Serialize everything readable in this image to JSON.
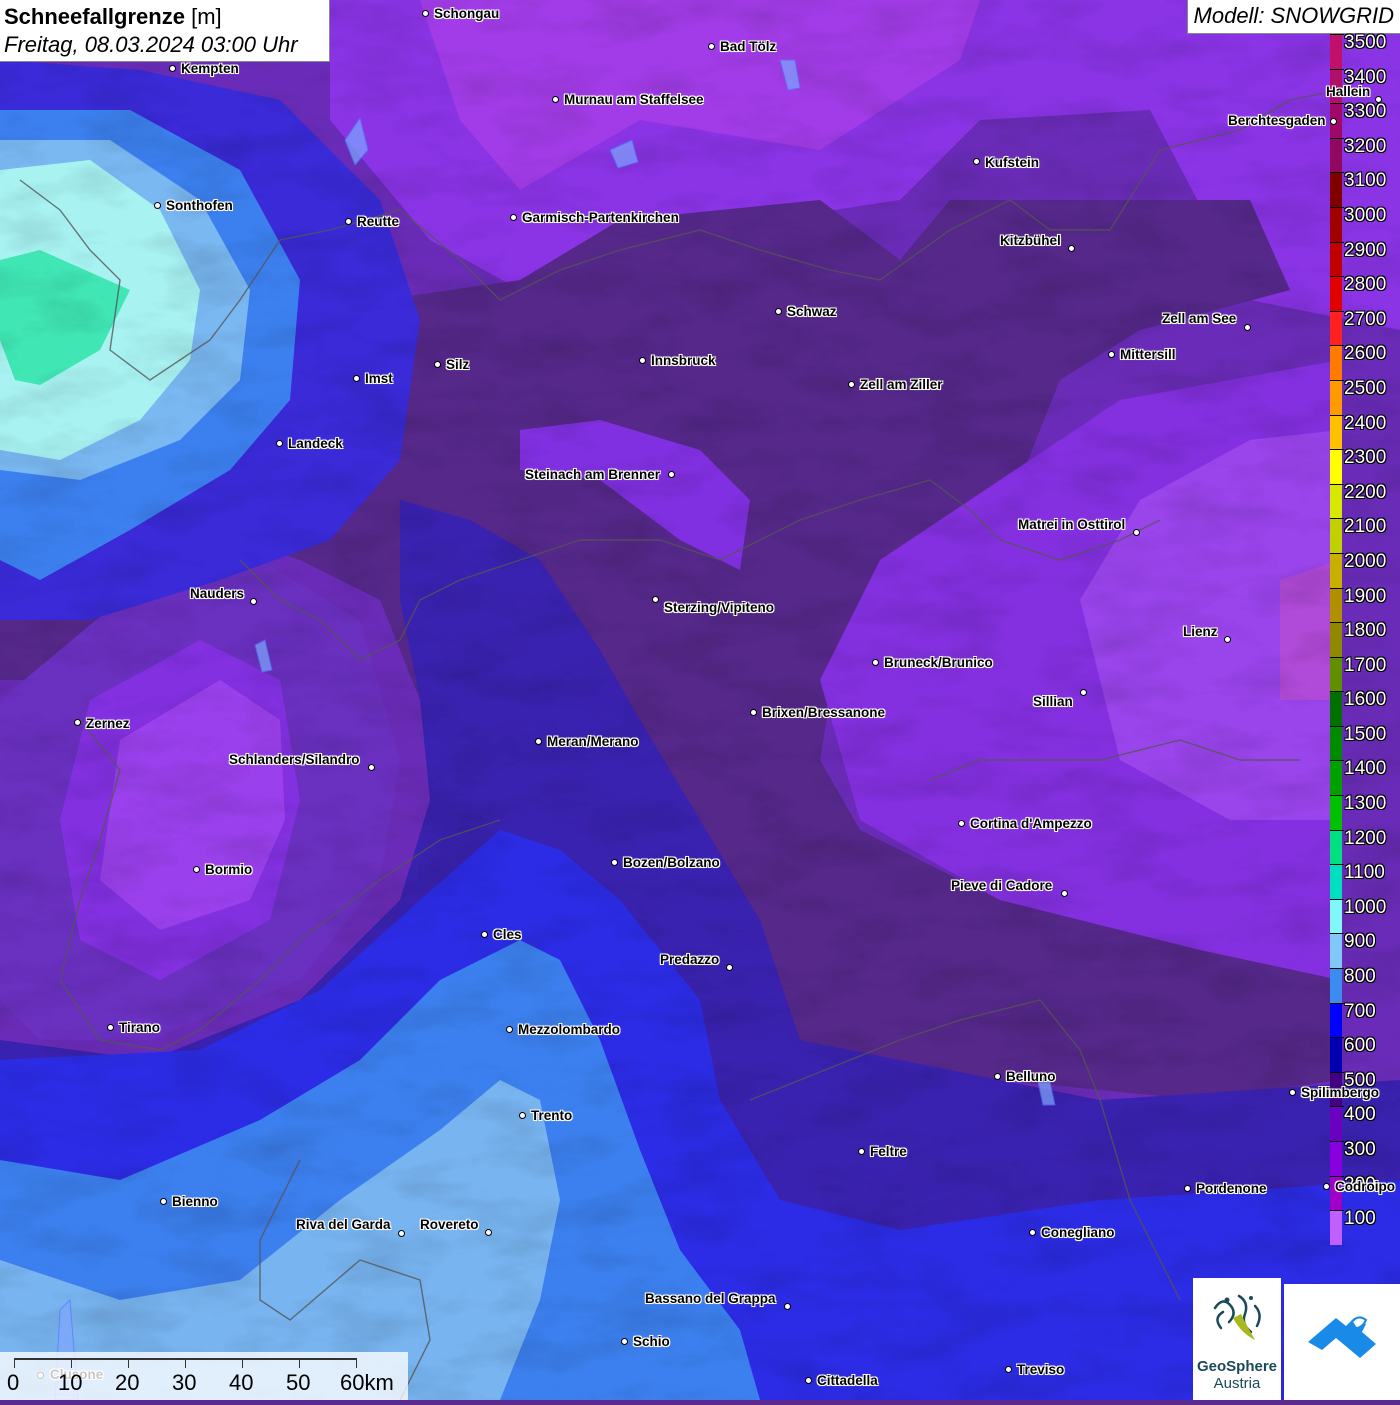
{
  "title": {
    "main_bold": "Schneefallgrenze",
    "main_unit": "[m]",
    "subtitle": "Freitag, 08.03.2024 03:00 Uhr"
  },
  "model": {
    "label": "Modell: SNOWGRID"
  },
  "legend": {
    "items": [
      {
        "label": "3500",
        "color": "#c0106a"
      },
      {
        "label": "3400",
        "color": "#b0106a"
      },
      {
        "label": "3300",
        "color": "#a00868"
      },
      {
        "label": "3200",
        "color": "#900860"
      },
      {
        "label": "3100",
        "color": "#800000"
      },
      {
        "label": "3000",
        "color": "#a00000"
      },
      {
        "label": "2900",
        "color": "#c00000"
      },
      {
        "label": "2800",
        "color": "#e00000"
      },
      {
        "label": "2700",
        "color": "#ff2020"
      },
      {
        "label": "2600",
        "color": "#ff7a00"
      },
      {
        "label": "2500",
        "color": "#ff9a00"
      },
      {
        "label": "2400",
        "color": "#ffc000"
      },
      {
        "label": "2300",
        "color": "#ffff00"
      },
      {
        "label": "2200",
        "color": "#d8e800"
      },
      {
        "label": "2100",
        "color": "#c0d000"
      },
      {
        "label": "2000",
        "color": "#c8b000"
      },
      {
        "label": "1900",
        "color": "#b09000"
      },
      {
        "label": "1800",
        "color": "#908800"
      },
      {
        "label": "1700",
        "color": "#609000"
      },
      {
        "label": "1600",
        "color": "#007000"
      },
      {
        "label": "1500",
        "color": "#008a00"
      },
      {
        "label": "1400",
        "color": "#00a000"
      },
      {
        "label": "1300",
        "color": "#00c000"
      },
      {
        "label": "1200",
        "color": "#00e080"
      },
      {
        "label": "1100",
        "color": "#00e0c0"
      },
      {
        "label": "1000",
        "color": "#80f8f8"
      },
      {
        "label": "900",
        "color": "#80c8f8"
      },
      {
        "label": "800",
        "color": "#3c8cf0"
      },
      {
        "label": "700",
        "color": "#0000ff"
      },
      {
        "label": "600",
        "color": "#0000b0"
      },
      {
        "label": "500",
        "color": "#400080"
      },
      {
        "label": "400",
        "color": "#6a00c0"
      },
      {
        "label": "300",
        "color": "#8800e0"
      },
      {
        "label": "200",
        "color": "#a000c8"
      },
      {
        "label": "100",
        "color": "#c060ff"
      }
    ]
  },
  "cities": [
    {
      "name": "Schongau"
    },
    {
      "name": "Bad Tölz"
    },
    {
      "name": "Kempten"
    },
    {
      "name": "Murnau am Staffelsee"
    },
    {
      "name": "Hallein"
    },
    {
      "name": "Berchtesgaden"
    },
    {
      "name": "Kufstein"
    },
    {
      "name": "Sonthofen"
    },
    {
      "name": "Reutte"
    },
    {
      "name": "Garmisch-Partenkirchen"
    },
    {
      "name": "Kitzbühel"
    },
    {
      "name": "Schwaz"
    },
    {
      "name": "Zell am See"
    },
    {
      "name": "Innsbruck"
    },
    {
      "name": "Mittersill"
    },
    {
      "name": "Imst"
    },
    {
      "name": "Silz"
    },
    {
      "name": "Zell am Ziller"
    },
    {
      "name": "Landeck"
    },
    {
      "name": "Steinach am Brenner"
    },
    {
      "name": "Matrei in Osttirol"
    },
    {
      "name": "Nauders"
    },
    {
      "name": "Sterzing/Vipiteno"
    },
    {
      "name": "Lienz"
    },
    {
      "name": "Bruneck/Brunico"
    },
    {
      "name": "Sillian"
    },
    {
      "name": "Zernez"
    },
    {
      "name": "Brixen/Bressanone"
    },
    {
      "name": "Meran/Merano"
    },
    {
      "name": "Schlanders/Silandro"
    },
    {
      "name": "Cortina d'Ampezzo"
    },
    {
      "name": "Bozen/Bolzano"
    },
    {
      "name": "Bormio"
    },
    {
      "name": "Pieve di Cadore"
    },
    {
      "name": "Cles"
    },
    {
      "name": "Predazzo"
    },
    {
      "name": "Tirano"
    },
    {
      "name": "Mezzolombardo"
    },
    {
      "name": "Belluno"
    },
    {
      "name": "Spilimbergo"
    },
    {
      "name": "Trento"
    },
    {
      "name": "Feltre"
    },
    {
      "name": "Pordenone"
    },
    {
      "name": "Codroipo"
    },
    {
      "name": "Bienno"
    },
    {
      "name": "Riva del Garda"
    },
    {
      "name": "Rovereto"
    },
    {
      "name": "Conegliano"
    },
    {
      "name": "Bassano del Grappa"
    },
    {
      "name": "Schio"
    },
    {
      "name": "Treviso"
    },
    {
      "name": "Cittadella"
    },
    {
      "name": "Clusone"
    }
  ],
  "scale": {
    "labels": [
      "0",
      "10",
      "20",
      "30",
      "40",
      "50",
      "60km"
    ]
  },
  "logos": {
    "geosphere_line1": "GeoSphere",
    "geosphere_line2": "Austria"
  },
  "colors": {
    "band_100": "#b25ae8",
    "band_200": "#9a3ce8",
    "band_300": "#8030e0",
    "band_400": "#6a2cb8",
    "band_500": "#55288a",
    "band_600": "#3a20a8",
    "band_700": "#2c2ce0",
    "band_800": "#3c7ef0",
    "band_900": "#78b8f0",
    "band_1000": "#a0f0f0",
    "band_1100": "#40e8b8"
  }
}
